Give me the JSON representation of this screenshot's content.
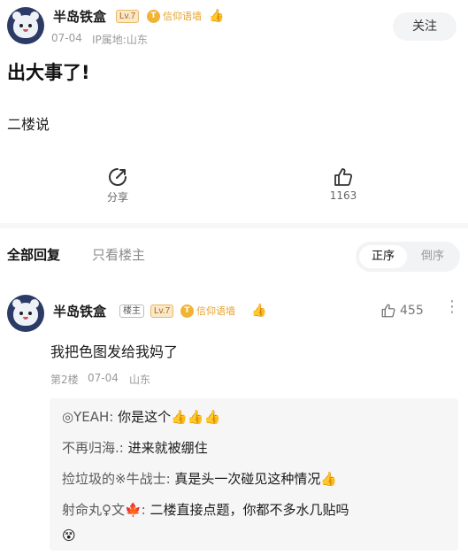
{
  "post": {
    "author": "半岛铁盒",
    "level": "Lv.7",
    "badge_label": "信仰语墙",
    "badge_glyph": "T",
    "emoji": "👍",
    "date": "07-04",
    "ip": "IP属地:山东",
    "follow_label": "关注",
    "title": "出大事了!",
    "body": "二楼说",
    "share_label": "分享",
    "likes": "1163"
  },
  "replies_header": {
    "tab_all": "全部回复",
    "tab_op": "只看楼主",
    "sort_asc": "正序",
    "sort_desc": "倒序"
  },
  "reply": {
    "author": "半岛铁盒",
    "op_tag": "楼主",
    "level": "Lv.7",
    "badge_label": "信仰语墙",
    "badge_glyph": "T",
    "emoji": "👍",
    "likes": "455",
    "more": "⋮",
    "text": "我把色图发给我妈了",
    "floor": "第2楼",
    "date": "07-04",
    "location": "山东"
  },
  "sub_replies": [
    {
      "name": "◎YEAH:",
      "text": " 你是这个👍👍👍"
    },
    {
      "name": "不再归海.:",
      "text": " 进来就被绷住"
    },
    {
      "name": "捡垃圾的※牛战士:",
      "text": " 真是头一次碰见这种情况👍"
    },
    {
      "name": "射命丸♀文🍁:",
      "text": " 二楼直接点题，你都不多水几贴吗"
    },
    {
      "name": "",
      "text": "😵"
    }
  ],
  "colors": {
    "accent_gold": "#f2b233",
    "level_bg": "#fbe8c8",
    "avatar_bg": "#2c3a66"
  }
}
